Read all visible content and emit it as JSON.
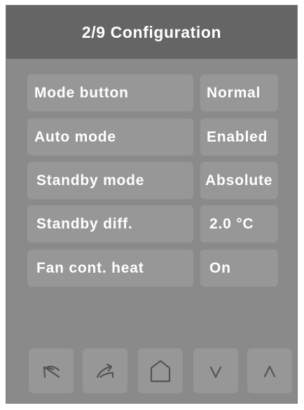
{
  "header": {
    "title": "2/9 Configuration"
  },
  "settings": [
    {
      "label": "Mode button",
      "value": "Normal"
    },
    {
      "label": "Auto mode",
      "value": "Enabled"
    },
    {
      "label": "Standby mode",
      "value": "Absolute"
    },
    {
      "label": "Standby diff.",
      "value": "2.0 °C"
    },
    {
      "label": "Fan cont. heat",
      "value": "On"
    }
  ],
  "navigation": {
    "buttons": [
      {
        "icon": "back-arrow-icon"
      },
      {
        "icon": "forward-arrow-icon"
      },
      {
        "icon": "home-icon"
      },
      {
        "icon": "chevron-down-icon"
      },
      {
        "icon": "chevron-up-icon"
      }
    ]
  },
  "colors": {
    "background": "#8a8a8a",
    "header": "#656565",
    "button": "#979797",
    "text": "#ffffff",
    "icon_stroke": "#555555"
  }
}
